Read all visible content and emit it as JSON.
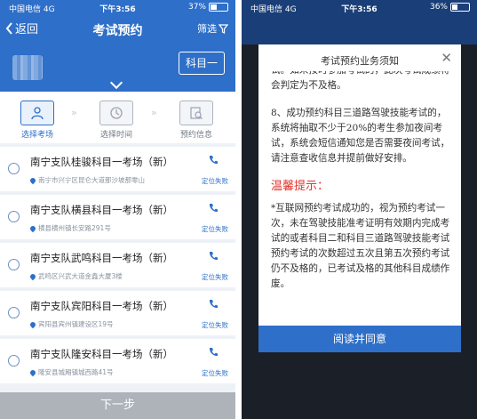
{
  "status_left": {
    "carrier": "中国电信",
    "network": "4G",
    "time": "下午3:56",
    "battery": "37%",
    "battery_level": 0.37
  },
  "status_right": {
    "carrier": "中国电信",
    "network": "4G",
    "time": "下午3:56",
    "battery": "36%",
    "battery_level": 0.36
  },
  "nav": {
    "back": "返回",
    "title": "考试预约",
    "filter": "筛选"
  },
  "subject_button": "科目一",
  "steps": [
    {
      "label": "选择考场",
      "active": true
    },
    {
      "label": "选择时间",
      "active": false
    },
    {
      "label": "预约信息",
      "active": false
    }
  ],
  "venues": [
    {
      "name": "南宁支队桂骏科目一考场（新）",
      "address": "南宁市兴宁区昆仑大道那沙坡那零山",
      "location": "定位失败"
    },
    {
      "name": "南宁支队横县科目一考场（新）",
      "address": "横县横州镇长安路291号",
      "location": "定位失败"
    },
    {
      "name": "南宁支队武鸣科目一考场（新）",
      "address": "武鸣区兴武大道金鑫大厦3楼",
      "location": "定位失败"
    },
    {
      "name": "南宁支队宾阳科目一考场（新）",
      "address": "宾阳县宾州镇建设区19号",
      "location": "定位失败"
    },
    {
      "name": "南宁支队隆安科目一考场（新）",
      "address": "隆安县城厢镇城西路41号",
      "location": "定位失败"
    }
  ],
  "next_button": "下一步",
  "modal": {
    "title": "考试预约业务须知",
    "p_top": "试。如未按时参加考试的，此次考试成绩将会判定为不及格。",
    "p8": "8、成功预约科目三道路驾驶技能考试的，系统将抽取不少于20%的考生参加夜间考试，系统会短信通知您是否需要夜间考试，请注意查收信息并提前做好安排。",
    "warm_tip": "温馨提示：",
    "p_tip": "*互联网预约考试成功的，视为预约考试一次，未在驾驶技能准考证明有效期内完成考试的或者科目二和科目三道路驾驶技能考试预约考试的次数超过五次且第五次预约考试仍不及格的，已考试及格的其他科目成绩作废。",
    "agree_button": "阅读并同意"
  }
}
